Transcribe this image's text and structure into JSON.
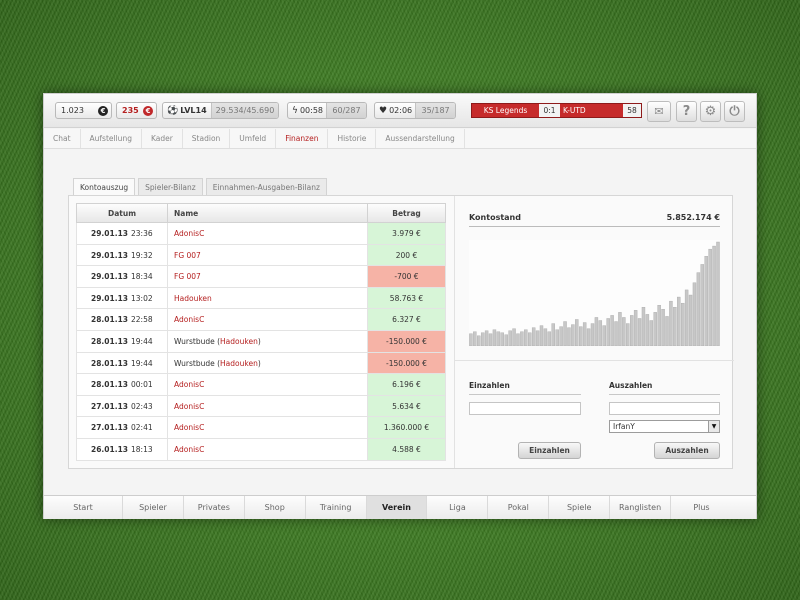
{
  "topbar": {
    "coins": "1.023",
    "coins_icon": "coin-icon",
    "premium": "235",
    "premium_icon": "premium-coin-icon",
    "level": "LVL14",
    "xp": "29.534/45.690",
    "energy_timer": "00:58",
    "energy": "60/287",
    "health_timer": "02:06",
    "health": "35/187",
    "match": {
      "home": "KS Legends",
      "score": "0:1",
      "away": "K-UTD",
      "minute": "58"
    }
  },
  "subnav": {
    "items": [
      "Chat",
      "Aufstellung",
      "Kader",
      "Stadion",
      "Umfeld",
      "Finanzen",
      "Historie",
      "Aussendarstellung"
    ],
    "active": "Finanzen"
  },
  "tabs": [
    "Kontoauszug",
    "Spieler-Bilanz",
    "Einnahmen-Ausgaben-Bilanz"
  ],
  "table": {
    "headers": {
      "date": "Datum",
      "name": "Name",
      "amount": "Betrag"
    },
    "rows": [
      {
        "date": "29.01.13",
        "time": "23:36",
        "name": "AdonisC",
        "suffix": "",
        "amount": "3.979 €",
        "type": "pos"
      },
      {
        "date": "29.01.13",
        "time": "19:32",
        "name": "FG 007",
        "suffix": "",
        "amount": "200 €",
        "type": "pos"
      },
      {
        "date": "29.01.13",
        "time": "18:34",
        "name": "FG 007",
        "suffix": "",
        "amount": "-700 €",
        "type": "neg"
      },
      {
        "date": "29.01.13",
        "time": "13:02",
        "name": "Hadouken",
        "suffix": "",
        "amount": "58.763 €",
        "type": "pos"
      },
      {
        "date": "28.01.13",
        "time": "22:58",
        "name": "AdonisC",
        "suffix": "",
        "amount": "6.327 €",
        "type": "pos"
      },
      {
        "date": "28.01.13",
        "time": "19:44",
        "name": "Wurstbude (",
        "link": "Hadouken",
        "suffix": ")",
        "amount": "-150.000 €",
        "type": "neg"
      },
      {
        "date": "28.01.13",
        "time": "19:44",
        "name": "Wurstbude (",
        "link": "Hadouken",
        "suffix": ")",
        "amount": "-150.000 €",
        "type": "neg"
      },
      {
        "date": "28.01.13",
        "time": "00:01",
        "name": "AdonisC",
        "suffix": "",
        "amount": "6.196 €",
        "type": "pos"
      },
      {
        "date": "27.01.13",
        "time": "02:43",
        "name": "AdonisC",
        "suffix": "",
        "amount": "5.634 €",
        "type": "pos"
      },
      {
        "date": "27.01.13",
        "time": "02:41",
        "name": "AdonisC",
        "suffix": "",
        "amount": "1.360.000 €",
        "type": "pos"
      },
      {
        "date": "26.01.13",
        "time": "18:13",
        "name": "AdonisC",
        "suffix": "",
        "amount": "4.588 €",
        "type": "pos"
      }
    ]
  },
  "kontostand": {
    "label": "Kontostand",
    "value": "5.852.174 €",
    "history": [
      12,
      14,
      10,
      13,
      15,
      12,
      16,
      14,
      13,
      11,
      15,
      17,
      12,
      14,
      16,
      13,
      18,
      15,
      20,
      17,
      14,
      22,
      16,
      19,
      24,
      18,
      21,
      26,
      19,
      23,
      17,
      22,
      28,
      25,
      20,
      27,
      30,
      24,
      33,
      28,
      22,
      30,
      35,
      27,
      38,
      31,
      25,
      33,
      40,
      36,
      29,
      44,
      38,
      48,
      42,
      55,
      50,
      62,
      72,
      80,
      88,
      95,
      98,
      102
    ]
  },
  "payments": {
    "deposit_label": "Einzahlen",
    "withdraw_label": "Auszahlen",
    "deposit_value": "",
    "withdraw_value": "",
    "recipient": "IrfanY",
    "deposit_button": "Einzahlen",
    "withdraw_button": "Auszahlen"
  },
  "bottomnav": {
    "items": [
      "Start",
      "Spieler",
      "Privates",
      "Shop",
      "Training",
      "Verein",
      "Liga",
      "Pokal",
      "Spiele",
      "Ranglisten",
      "Plus"
    ],
    "active": "Verein"
  },
  "colors": {
    "accent": "#c62b2b",
    "positive": "#d7f5d7",
    "negative": "#f6b3a6"
  }
}
